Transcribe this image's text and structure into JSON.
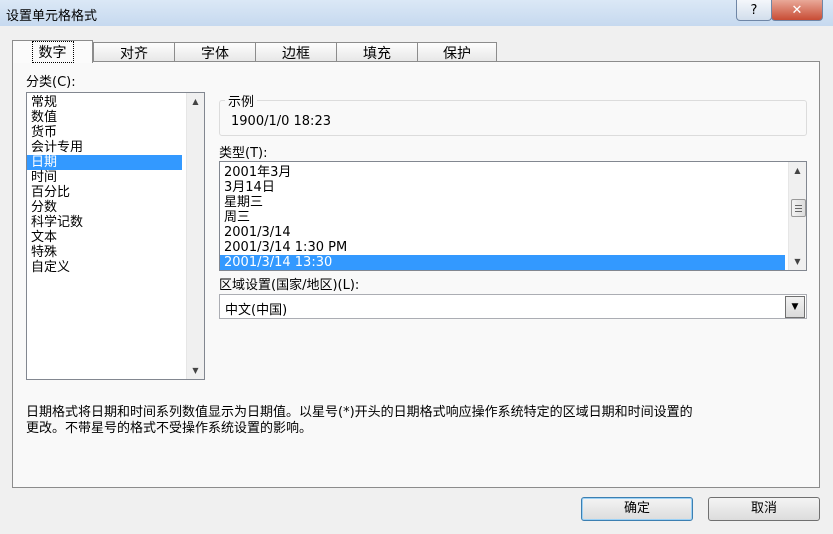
{
  "window": {
    "title": "设置单元格格式",
    "help_glyph": "?",
    "close_glyph": "✕"
  },
  "tabs": [
    {
      "label": "数字",
      "active": true
    },
    {
      "label": "对齐"
    },
    {
      "label": "字体"
    },
    {
      "label": "边框"
    },
    {
      "label": "填充"
    },
    {
      "label": "保护"
    }
  ],
  "category": {
    "label": "分类(C):",
    "items": [
      "常规",
      "数值",
      "货币",
      "会计专用",
      "日期",
      "时间",
      "百分比",
      "分数",
      "科学记数",
      "文本",
      "特殊",
      "自定义"
    ],
    "selected_index": 4
  },
  "sample": {
    "label": "示例",
    "value": "1900/1/0 18:23"
  },
  "type": {
    "label": "类型(T):",
    "items": [
      "2001年3月",
      "3月14日",
      "星期三",
      "周三",
      "2001/3/14",
      "2001/3/14 1:30 PM",
      "2001/3/14 13:30"
    ],
    "selected_index": 6
  },
  "locale": {
    "label": "区域设置(国家/地区)(L):",
    "value": "中文(中国)"
  },
  "description": {
    "line1": "日期格式将日期和时间系列数值显示为日期值。以星号(*)开头的日期格式响应操作系统特定的区域日期和时间设置的",
    "line2": "更改。不带星号的格式不受操作系统设置的影响。"
  },
  "buttons": {
    "ok": "确定",
    "cancel": "取消"
  },
  "colors": {
    "selection": "#3399ff",
    "title_bar": "#cfe0f2",
    "dialog_bg": "#f0f0f0"
  }
}
